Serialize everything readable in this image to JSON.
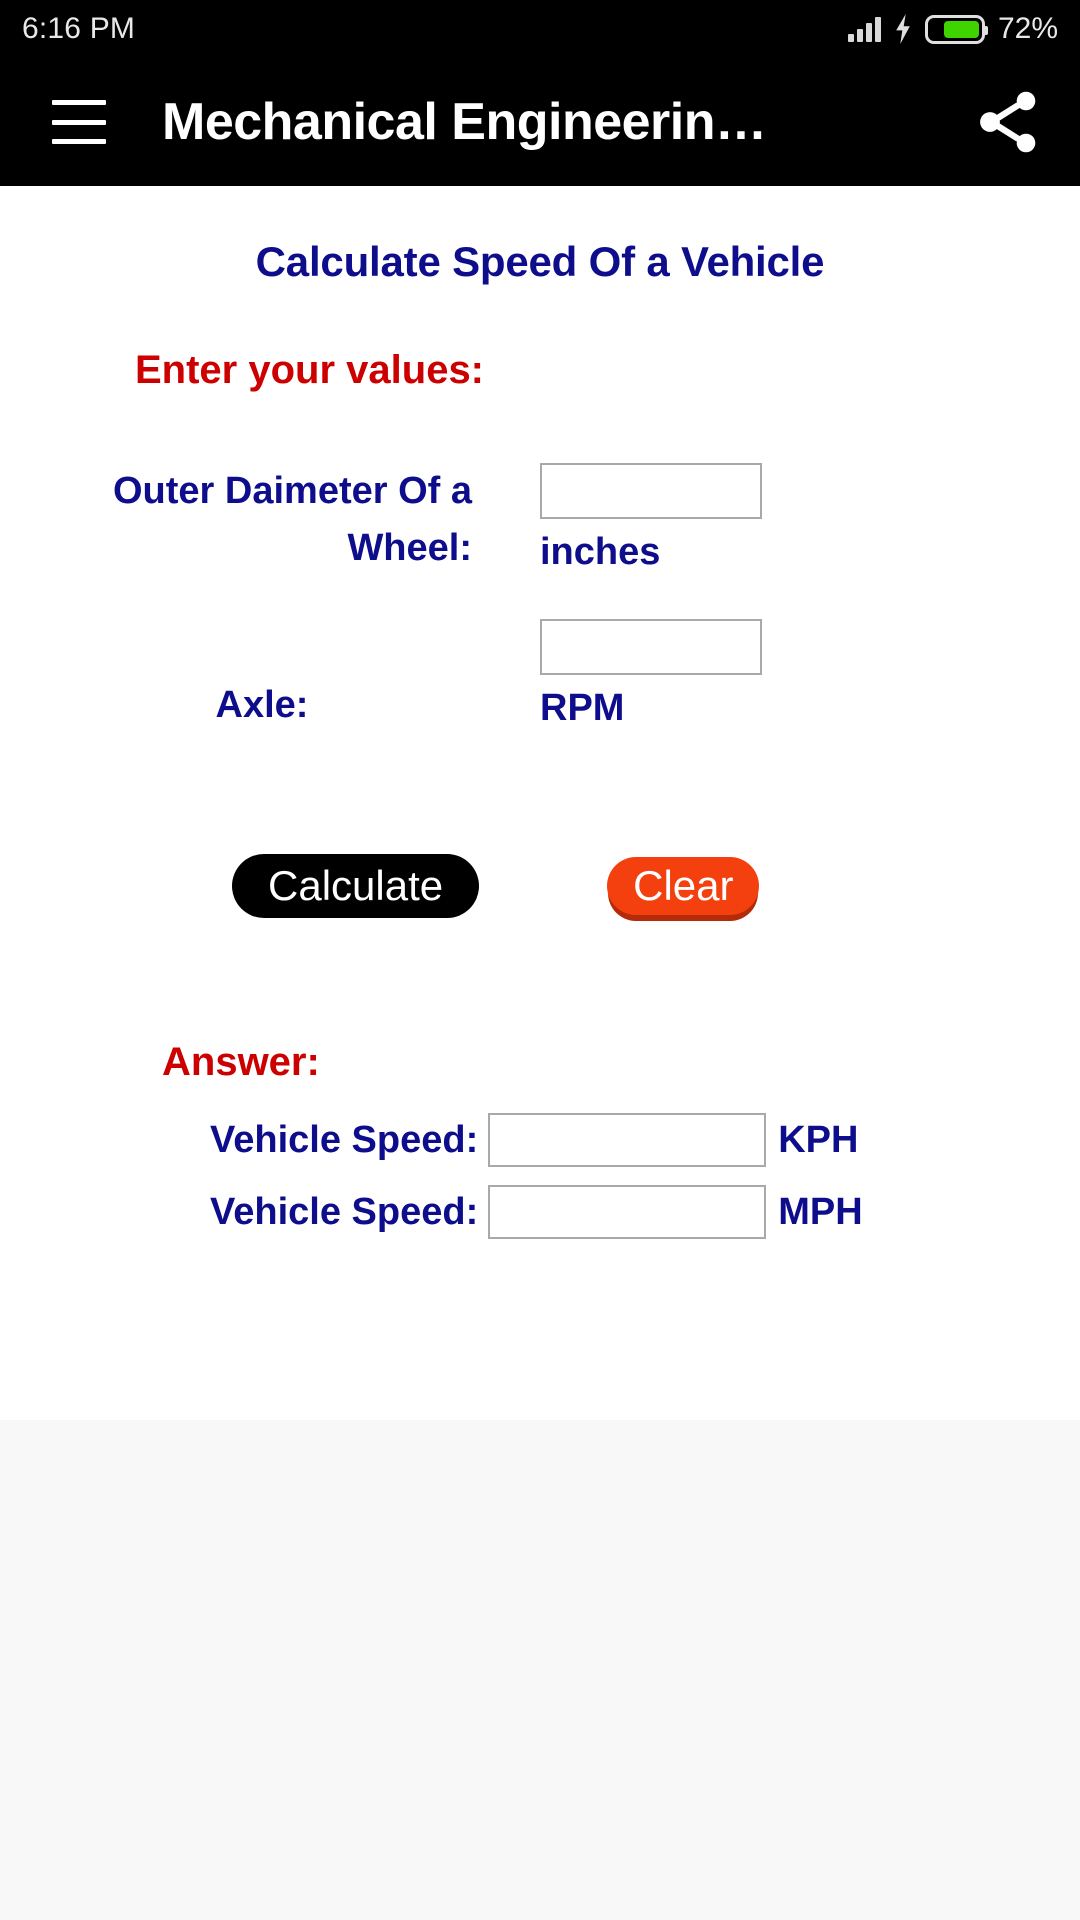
{
  "status_bar": {
    "time": "6:16 PM",
    "battery_percent": "72%",
    "battery_level": 72,
    "signal_icon": "signal-bars-icon",
    "charging_icon": "lightning-bolt-icon",
    "battery_icon": "battery-icon",
    "battery_color": "#3fd400"
  },
  "app_bar": {
    "menu_icon": "hamburger-menu-icon",
    "title": "Mechanical Engineerin…",
    "share_icon": "share-icon",
    "background": "#000000"
  },
  "page": {
    "title": "Calculate Speed Of a Vehicle",
    "title_color": "#0e0e8c",
    "accent_red": "#cc0000"
  },
  "input_section": {
    "heading": "Enter your values:",
    "fields": [
      {
        "label": "Outer Daimeter Of a Wheel:",
        "value": "",
        "unit": "inches"
      },
      {
        "label": "Axle:",
        "value": "",
        "unit": "RPM"
      }
    ]
  },
  "buttons": {
    "calculate": "Calculate",
    "clear": "Clear",
    "calculate_color": "#000000",
    "clear_color": "#f4400f"
  },
  "answer_section": {
    "heading": "Answer:",
    "results": [
      {
        "label": "Vehicle Speed:",
        "value": "",
        "unit": "KPH"
      },
      {
        "label": "Vehicle Speed:",
        "value": "",
        "unit": "MPH"
      }
    ]
  }
}
